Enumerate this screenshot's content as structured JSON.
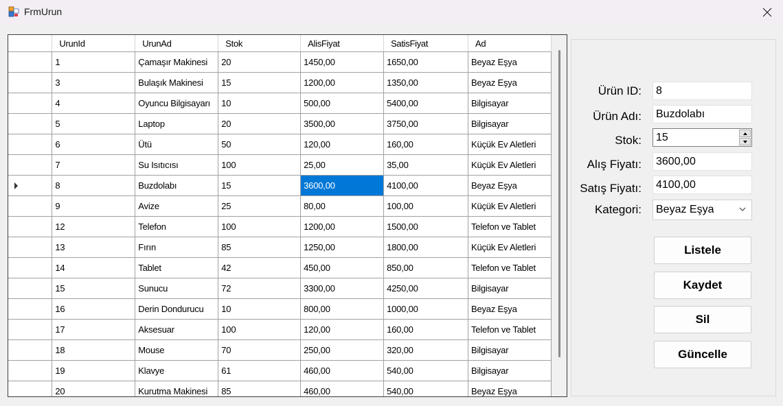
{
  "window": {
    "title": "FrmUrun"
  },
  "grid": {
    "columns": [
      "UrunId",
      "UrunAd",
      "Stok",
      "AlisFiyat",
      "SatisFiyat",
      "Ad"
    ],
    "current_row_index": 6,
    "selected_cell": {
      "row": 6,
      "col": 3
    },
    "rows": [
      [
        "1",
        "Çamaşır Makinesi",
        "20",
        "1450,00",
        "1650,00",
        "Beyaz Eşya"
      ],
      [
        "3",
        "Bulaşık Makinesi",
        "15",
        "1200,00",
        "1350,00",
        "Beyaz Eşya"
      ],
      [
        "4",
        "Oyuncu Bilgisayarı",
        "10",
        "500,00",
        "5400,00",
        "Bilgisayar"
      ],
      [
        "5",
        "Laptop",
        "20",
        "3500,00",
        "3750,00",
        "Bilgisayar"
      ],
      [
        "6",
        "Ütü",
        "50",
        "120,00",
        "160,00",
        "Küçük Ev Aletleri"
      ],
      [
        "7",
        "Su Isıtıcısı",
        "100",
        "25,00",
        "35,00",
        "Küçük Ev Aletleri"
      ],
      [
        "8",
        "Buzdolabı",
        "15",
        "3600,00",
        "4100,00",
        "Beyaz Eşya"
      ],
      [
        "9",
        "Avize",
        "25",
        "80,00",
        "100,00",
        "Küçük Ev Aletleri"
      ],
      [
        "12",
        "Telefon",
        "100",
        "1200,00",
        "1500,00",
        "Telefon ve Tablet"
      ],
      [
        "13",
        "Fırın",
        "85",
        "1250,00",
        "1800,00",
        "Küçük Ev Aletleri"
      ],
      [
        "14",
        "Tablet",
        "42",
        "450,00",
        "850,00",
        "Telefon ve Tablet"
      ],
      [
        "15",
        "Sunucu",
        "72",
        "3300,00",
        "4250,00",
        "Bilgisayar"
      ],
      [
        "16",
        "Derin Dondurucu",
        "10",
        "800,00",
        "1000,00",
        "Beyaz Eşya"
      ],
      [
        "17",
        "Aksesuar",
        "100",
        "120,00",
        "160,00",
        "Telefon ve Tablet"
      ],
      [
        "18",
        "Mouse",
        "70",
        "250,00",
        "320,00",
        "Bilgisayar"
      ],
      [
        "19",
        "Klavye",
        "61",
        "460,00",
        "540,00",
        "Bilgisayar"
      ],
      [
        "20",
        "Kurutma Makinesi",
        "85",
        "460,00",
        "540,00",
        "Beyaz Eşya"
      ]
    ]
  },
  "form": {
    "id_label": "Ürün ID:",
    "id_value": "8",
    "name_label": "Ürün Adı:",
    "name_value": "Buzdolabı",
    "stock_label": "Stok:",
    "stock_value": "15",
    "buy_label": "Alış Fiyatı:",
    "buy_value": "3600,00",
    "sell_label": "Satış Fiyatı:",
    "sell_value": "4100,00",
    "category_label": "Kategori:",
    "category_value": "Beyaz Eşya"
  },
  "buttons": {
    "list": "Listele",
    "save": "Kaydet",
    "delete": "Sil",
    "update": "Güncelle"
  },
  "colors": {
    "selection": "#0078d7",
    "titlebar": "#f3eef4"
  }
}
